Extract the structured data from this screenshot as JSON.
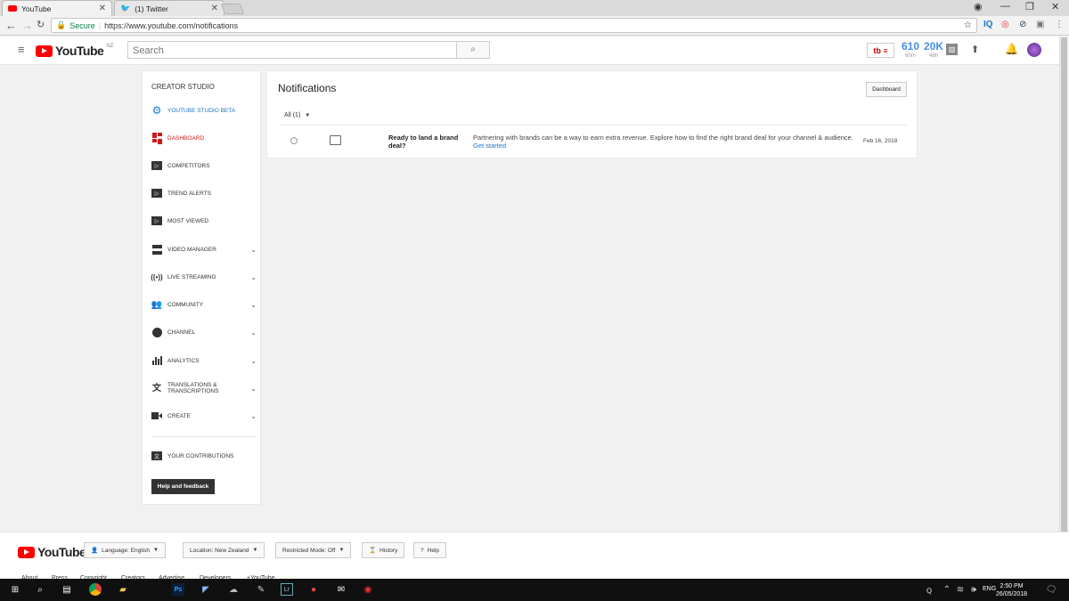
{
  "browser": {
    "tabs": [
      {
        "label": "YouTube",
        "icon": "youtube-favicon"
      },
      {
        "label": "(1) Twitter",
        "icon": "twitter-favicon"
      }
    ],
    "secure_label": "Secure",
    "url": "https://www.youtube.com/notifications"
  },
  "header": {
    "logo_text": "YouTube",
    "logo_region": "NZ",
    "search_placeholder": "Search",
    "stats": [
      {
        "value": "610",
        "caption": "60m"
      },
      {
        "value": "20K",
        "caption": "48h"
      }
    ]
  },
  "sidebar": {
    "title": "CREATOR STUDIO",
    "items": [
      {
        "label": "YOUTUBE STUDIO BETA",
        "icon": "gear-icon",
        "color": "#1a73c9"
      },
      {
        "label": "DASHBOARD",
        "icon": "dashboard-icon",
        "color": "#cc1a1a"
      },
      {
        "label": "COMPETITORS",
        "icon": "tubebuddy-icon"
      },
      {
        "label": "TREND ALERTS",
        "icon": "tubebuddy-icon"
      },
      {
        "label": "MOST VIEWED",
        "icon": "tubebuddy-icon"
      },
      {
        "label": "VIDEO MANAGER",
        "icon": "video-manager-icon"
      },
      {
        "label": "LIVE STREAMING",
        "icon": "live-icon"
      },
      {
        "label": "COMMUNITY",
        "icon": "community-icon"
      },
      {
        "label": "CHANNEL",
        "icon": "channel-icon"
      },
      {
        "label": "ANALYTICS",
        "icon": "analytics-icon"
      },
      {
        "label": "TRANSLATIONS & TRANSCRIPTIONS",
        "icon": "translate-icon"
      },
      {
        "label": "CREATE",
        "icon": "create-icon"
      },
      {
        "label": "YOUR CONTRIBUTIONS",
        "icon": "contributions-icon"
      }
    ],
    "help_label": "Help and feedback"
  },
  "notifications": {
    "title": "Notifications",
    "dashboard_button": "Dashboard",
    "filter_label": "All (1)",
    "item": {
      "heading": "Ready to land a brand deal?",
      "body": "Partnering with brands can be a way to earn extra revenue. Explore how to find the right brand deal for your channel & audience.",
      "link": "Get started",
      "date": "Feb 16, 2018"
    }
  },
  "footer": {
    "language": "Language: English",
    "location": "Location: New Zealand",
    "restricted": "Restricted Mode: Off",
    "history": "History",
    "help": "Help",
    "links": [
      "About",
      "Press",
      "Copyright",
      "Creators",
      "Advertise",
      "Developers",
      "+YouTube"
    ]
  },
  "taskbar": {
    "lang": "ENG",
    "time": "2:50 PM",
    "date": "26/05/2018"
  }
}
